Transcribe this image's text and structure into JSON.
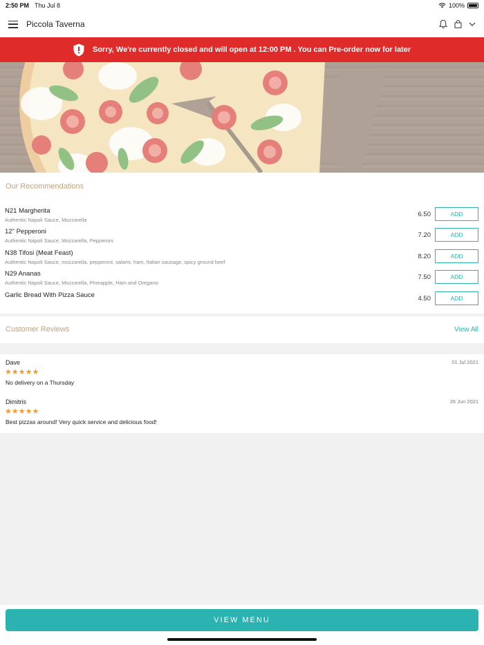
{
  "status_bar": {
    "time": "2:50 PM",
    "date": "Thu Jul 8",
    "battery": "100%"
  },
  "header": {
    "title": "Piccola Taverna",
    "icons": [
      "hamburger-menu-icon",
      "bell-icon",
      "bag-icon",
      "chevron-down-icon"
    ]
  },
  "banner": {
    "message": "Sorry, We're currently closed and will open at 12:00 PM . You can Pre-order now for later",
    "color": "#e02b2b"
  },
  "recommendations": {
    "title": "Our Recommendations",
    "items": [
      {
        "name": "N21 Margherita",
        "description": "Authentic Napoli Sauce, Mozzarella",
        "price": "6.50",
        "action": "ADD"
      },
      {
        "name": "12\" Pepperoni",
        "description": "Authentic Napoli Sauce, Mozzarella, Pepperoni",
        "price": "7.20",
        "action": "ADD"
      },
      {
        "name": "N38 Tifosi (Meat Feast)",
        "description": "Authentic Napoli Sauce, mozzarella, pepperoni, salami, ham, Italian sausage, spicy ground beef",
        "price": "8.20",
        "action": "ADD"
      },
      {
        "name": "N29 Ananas",
        "description": "Authentic Napoli Sauce, Mozzarella, Pineapple, Ham and Oregano",
        "price": "7.50",
        "action": "ADD"
      },
      {
        "name": "Garlic Bread With Pizza Sauce",
        "description": "",
        "price": "4.50",
        "action": "ADD"
      }
    ]
  },
  "reviews": {
    "title": "Customer Reviews",
    "view_all": "View All",
    "items": [
      {
        "author": "Dave",
        "date": "01 Jul 2021",
        "stars": "★★★★★",
        "rating": 5,
        "text": "No delivery on a Thursday"
      },
      {
        "author": "Dimitris",
        "date": "26 Jun 2021",
        "stars": "★★★★★",
        "rating": 5,
        "text": "Best pizzas around! Very quick service and delicious food!"
      }
    ]
  },
  "footer": {
    "button_label": "VIEW MENU"
  },
  "colors": {
    "accent": "#2ab3b0",
    "section_title": "#c2a27a",
    "star": "#f29a2e",
    "alert": "#e02b2b"
  }
}
